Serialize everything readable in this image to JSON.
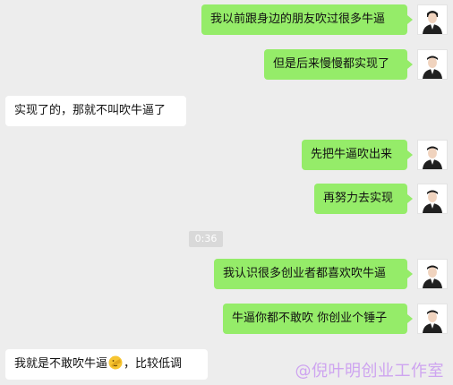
{
  "messages": [
    {
      "side": "right",
      "text": "我以前跟身边的朋友吹过很多牛逼"
    },
    {
      "side": "right",
      "text": "但是后来慢慢都实现了"
    },
    {
      "side": "left",
      "text": "实现了的，那就不叫吹牛逼了"
    },
    {
      "side": "right",
      "text": "先把牛逼吹出来"
    },
    {
      "side": "right",
      "text": "再努力去实现"
    },
    {
      "side": "right",
      "text": "我认识很多创业者都喜欢吹牛逼"
    },
    {
      "side": "right",
      "text": "牛逼你都不敢吹 你创业个锤子"
    },
    {
      "side": "left",
      "text_before": "我就是不敢吹牛逼",
      "emoji": "facepalm-emoji",
      "text_after": "，比较低调"
    }
  ],
  "timestamp": "0:36",
  "watermark": "@倪叶明创业工作室",
  "colors": {
    "background": "#ededed",
    "outgoing_bubble": "#95ec69",
    "incoming_bubble": "#ffffff",
    "timestamp_bg": "#d9d9d9",
    "watermark": "#c896f0"
  }
}
